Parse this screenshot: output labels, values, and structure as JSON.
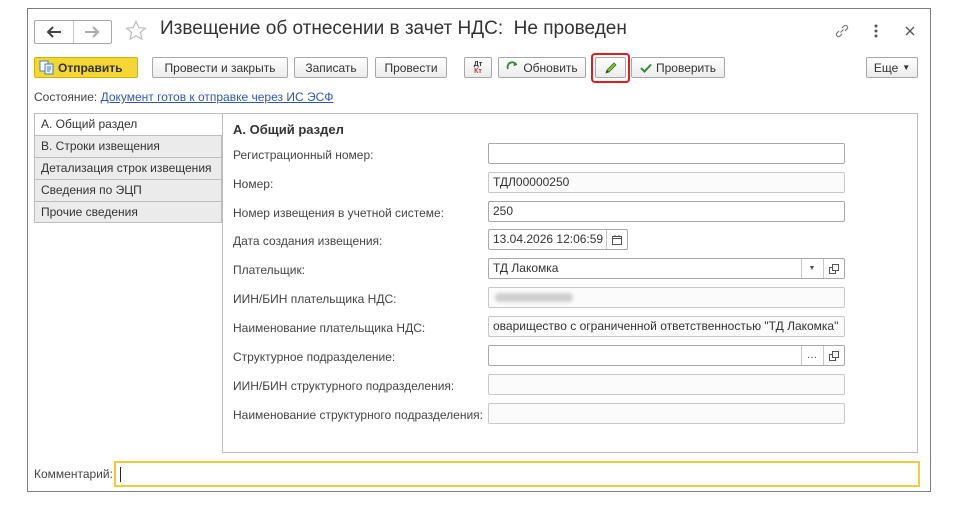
{
  "window": {
    "title": "Извещение об отнесении в зачет НДС:",
    "status_title": "Не проведен"
  },
  "toolbar": {
    "send_label": "Отправить",
    "post_close_label": "Провести и закрыть",
    "save_label": "Записать",
    "post_label": "Провести",
    "dt_kt_label_top": "Дт",
    "dt_kt_label_bottom": "Кт",
    "refresh_label": "Обновить",
    "check_label": "Проверить",
    "more_label": "Еще"
  },
  "status": {
    "label": "Состояние:",
    "link": "Документ готов к отправке через ИС ЭСФ"
  },
  "tabs": [
    {
      "label": "А. Общий раздел",
      "active": true
    },
    {
      "label": "В. Строки извещения",
      "active": false
    },
    {
      "label": "Детализация строк извещения",
      "active": false
    },
    {
      "label": "Сведения по ЭЦП",
      "active": false
    },
    {
      "label": "Прочие сведения",
      "active": false
    }
  ],
  "section": {
    "title": "А. Общий раздел",
    "fields": {
      "reg_number": {
        "label": "Регистрационный номер:",
        "value": ""
      },
      "number": {
        "label": "Номер:",
        "value": "ТДЛ00000250"
      },
      "acc_number": {
        "label": "Номер извещения в учетной системе:",
        "value": "250"
      },
      "created": {
        "label": "Дата создания извещения:",
        "value": "13.04.2026 12:06:59"
      },
      "payer": {
        "label": "Плательщик:",
        "value": "ТД Лакомка"
      },
      "payer_bin": {
        "label": "ИИН/БИН плательщика НДС:",
        "value": ""
      },
      "payer_name": {
        "label": "Наименование плательщика НДС:",
        "value": "овариществo с ограниченной ответственностью \"ТД Лакомка\""
      },
      "division": {
        "label": "Структурное подразделение:",
        "value": ""
      },
      "division_bin": {
        "label": "ИИН/БИН структурного подразделения:",
        "value": ""
      },
      "division_name": {
        "label": "Наименование структурного подразделения:",
        "value": ""
      }
    }
  },
  "comment": {
    "label": "Комментарий:",
    "value": ""
  },
  "colors": {
    "accent_yellow": "#f4d732",
    "highlight_red": "#d91f1f",
    "link_blue": "#2f58b0"
  },
  "icons": [
    "back-arrow-icon",
    "forward-arrow-icon",
    "star-icon",
    "link-icon",
    "more-vertical-icon",
    "close-icon",
    "refresh-icon",
    "pencil-icon",
    "checkmark-icon",
    "calendar-icon",
    "dropdown-icon",
    "open-icon"
  ]
}
